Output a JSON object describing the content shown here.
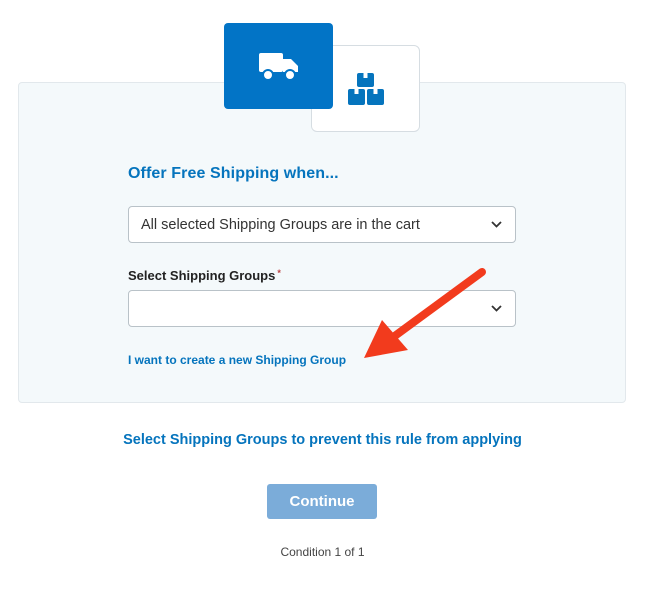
{
  "rule_type_tiles": [
    {
      "name": "free-shipping",
      "icon": "truck-icon",
      "selected": true
    },
    {
      "name": "product-groups",
      "icon": "boxes-icon",
      "selected": false
    }
  ],
  "form": {
    "heading": "Offer Free Shipping when...",
    "condition_select": {
      "value": "All selected Shipping Groups are in the cart"
    },
    "groups_label": "Select Shipping Groups",
    "required_marker": "*",
    "groups_select": {
      "value": ""
    },
    "create_link": "I want to create a new Shipping Group"
  },
  "hint": "Select Shipping Groups to prevent this rule from applying",
  "continue_label": "Continue",
  "condition_counter": "Condition 1 of 1",
  "colors": {
    "accent": "#0574bd",
    "tile_selected": "#0274c6",
    "button_disabled": "#7bacd9",
    "annotation_arrow": "#f23b1d"
  }
}
